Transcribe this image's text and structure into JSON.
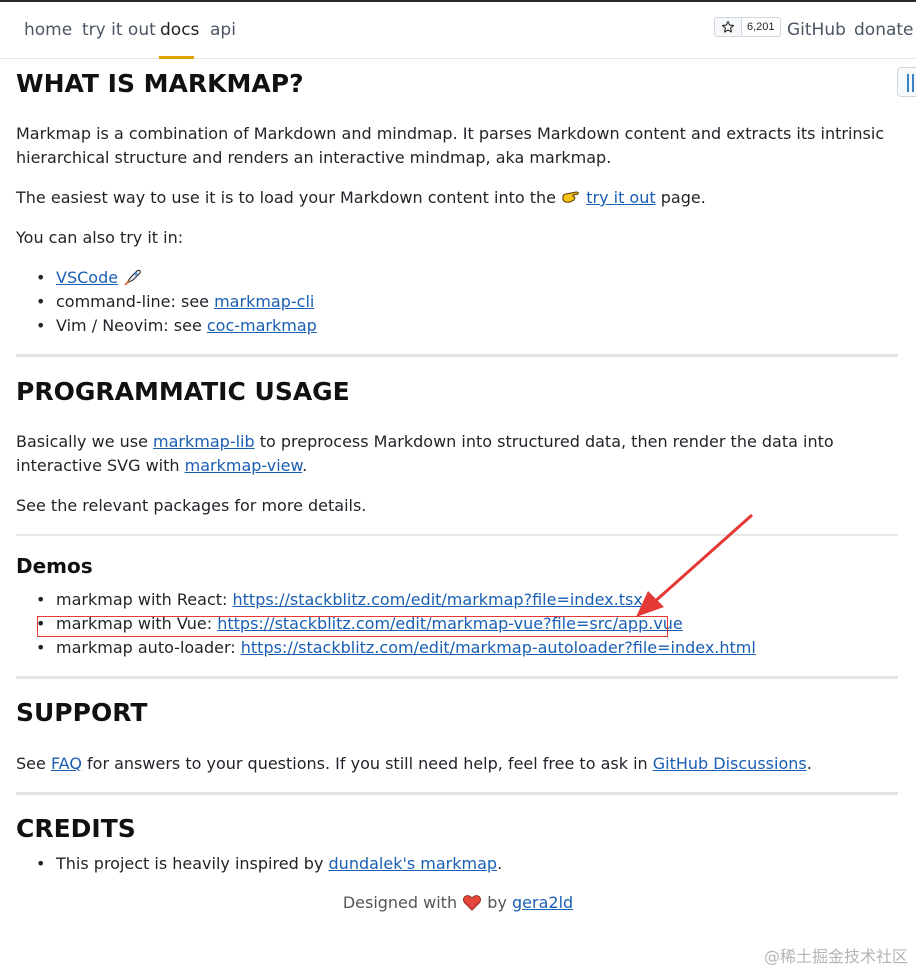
{
  "nav": {
    "items": [
      "home",
      "try it out",
      "docs",
      "api"
    ],
    "active": "docs",
    "star_count": "6,201",
    "github": "GitHub",
    "donate": "donate"
  },
  "sections": {
    "what": {
      "heading": "WHAT IS MARKMAP?",
      "para1": "Markmap is a combination of Markdown and mindmap. It parses Markdown content and extracts its intrinsic hierarchical structure and renders an interactive mindmap, aka markmap.",
      "para2_before": "The easiest way to use it is to load your Markdown content into the",
      "para2_link": "try it out",
      "para2_after": "page.",
      "para3": "You can also try it in:",
      "list": [
        {
          "link": "VSCode"
        },
        {
          "prefix": "command-line: see ",
          "link": "markmap-cli"
        },
        {
          "prefix": "Vim / Neovim: see ",
          "link": "coc-markmap"
        }
      ]
    },
    "programmatic": {
      "heading": "PROGRAMMATIC USAGE",
      "para1_a": "Basically we use ",
      "para1_link1": "markmap-lib",
      "para1_b": " to preprocess Markdown into structured data, then render the data into interactive SVG with ",
      "para1_link2": "markmap-view",
      "para1_c": ".",
      "para2": "See the relevant packages for more details."
    },
    "demos": {
      "heading": "Demos",
      "list": [
        {
          "prefix": "markmap with React: ",
          "link": "https://stackblitz.com/edit/markmap?file=index.tsx"
        },
        {
          "prefix": "markmap with Vue: ",
          "link": "https://stackblitz.com/edit/markmap-vue?file=src/app.vue"
        },
        {
          "prefix": "markmap auto-loader: ",
          "link": "https://stackblitz.com/edit/markmap-autoloader?file=index.html"
        }
      ]
    },
    "support": {
      "heading": "SUPPORT",
      "a": "See ",
      "link1": "FAQ",
      "b": " for answers to your questions. If you still need help, feel free to ask in ",
      "link2": "GitHub Discussions",
      "c": "."
    },
    "credits": {
      "heading": "CREDITS",
      "prefix": "This project is heavily inspired by ",
      "link": "dundalek's markmap",
      "suffix": "."
    }
  },
  "footer": {
    "before": "Designed with",
    "by": "by",
    "link": "gera2ld"
  },
  "watermark": "@稀土掘金技术社区",
  "colors": {
    "link": "#1a5fb4",
    "active_underline": "#e2a400",
    "annotation_red": "#e53935"
  }
}
